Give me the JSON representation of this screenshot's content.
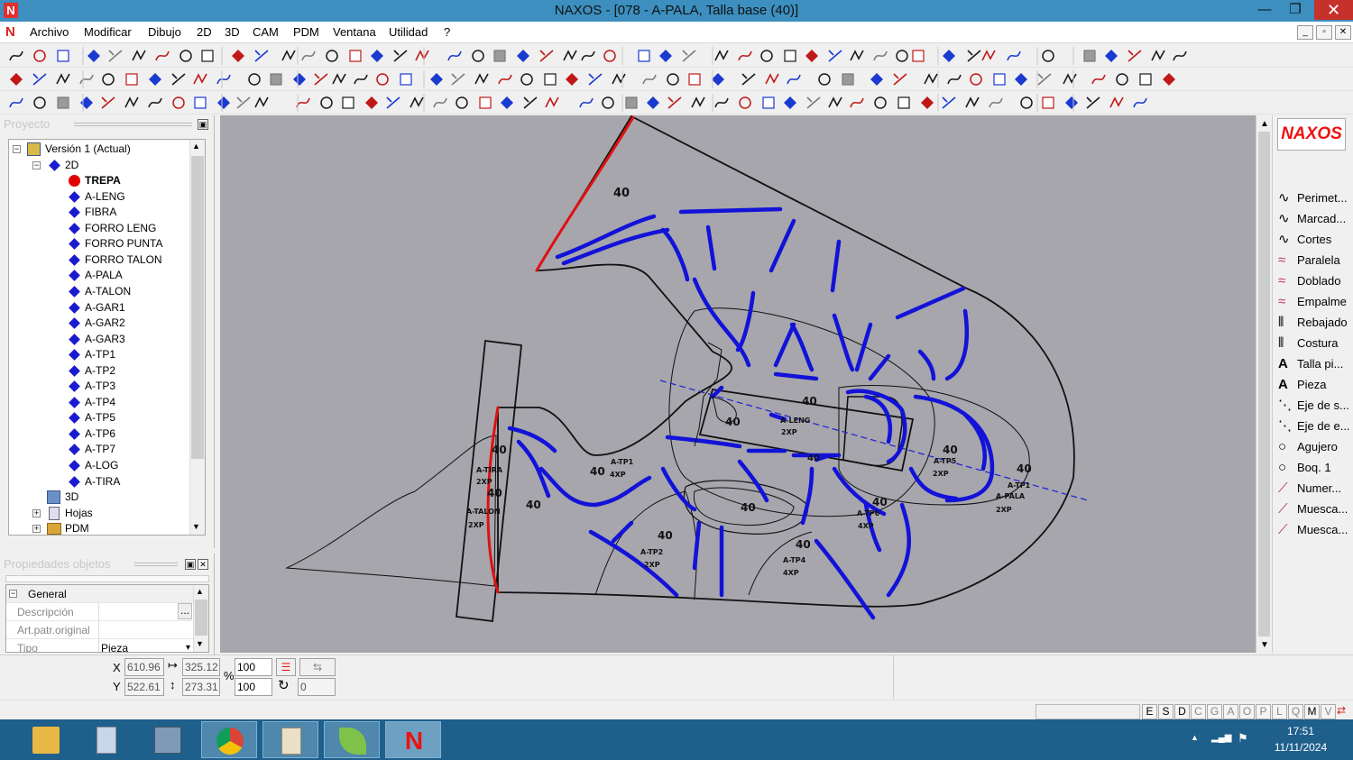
{
  "window": {
    "title": "NAXOS - [078 - A-PALA, Talla base (40)]",
    "logo": "N",
    "minimize": "—",
    "restore": "❐",
    "close": "✕"
  },
  "menu": [
    "Archivo",
    "Modificar",
    "Dibujo",
    "2D",
    "3D",
    "CAM",
    "PDM",
    "Ventana",
    "Utilidad",
    "?"
  ],
  "mdi": {
    "minimize": "_",
    "restore": "▫",
    "close": "✕"
  },
  "project_panel": {
    "title": "Proyecto",
    "pin": "▣"
  },
  "tree": [
    {
      "label": "Versión 1 (Actual)",
      "level": 0,
      "icon": "version-icon",
      "expander": "−"
    },
    {
      "label": "2D",
      "level": 1,
      "icon": "layer2d-icon",
      "expander": "−"
    },
    {
      "label": "TREPA",
      "level": 2,
      "icon": "red-dot-icon",
      "bold": true
    },
    {
      "label": "A-LENG",
      "level": 2,
      "icon": "diamond-icon"
    },
    {
      "label": "FIBRA",
      "level": 2,
      "icon": "diamond-icon"
    },
    {
      "label": "FORRO LENG",
      "level": 2,
      "icon": "diamond-icon"
    },
    {
      "label": "FORRO PUNTA",
      "level": 2,
      "icon": "diamond-icon"
    },
    {
      "label": "FORRO TALON",
      "level": 2,
      "icon": "diamond-icon"
    },
    {
      "label": "A-PALA",
      "level": 2,
      "icon": "diamond-icon"
    },
    {
      "label": "A-TALON",
      "level": 2,
      "icon": "diamond-icon"
    },
    {
      "label": "A-GAR1",
      "level": 2,
      "icon": "diamond-icon"
    },
    {
      "label": "A-GAR2",
      "level": 2,
      "icon": "diamond-icon"
    },
    {
      "label": "A-GAR3",
      "level": 2,
      "icon": "diamond-icon"
    },
    {
      "label": "A-TP1",
      "level": 2,
      "icon": "diamond-icon"
    },
    {
      "label": "A-TP2",
      "level": 2,
      "icon": "diamond-icon"
    },
    {
      "label": "A-TP3",
      "level": 2,
      "icon": "diamond-icon"
    },
    {
      "label": "A-TP4",
      "level": 2,
      "icon": "diamond-icon"
    },
    {
      "label": "A-TP5",
      "level": 2,
      "icon": "diamond-icon"
    },
    {
      "label": "A-TP6",
      "level": 2,
      "icon": "diamond-icon"
    },
    {
      "label": "A-TP7",
      "level": 2,
      "icon": "diamond-icon"
    },
    {
      "label": "A-LOG",
      "level": 2,
      "icon": "diamond-icon"
    },
    {
      "label": "A-TIRA",
      "level": 2,
      "icon": "diamond-icon"
    },
    {
      "label": "3D",
      "level": 1,
      "icon": "cube-icon"
    },
    {
      "label": "Hojas",
      "level": 1,
      "icon": "doc-icon",
      "expander": "+"
    },
    {
      "label": "PDM",
      "level": 1,
      "icon": "folder-icon",
      "expander": "+"
    }
  ],
  "props_panel": {
    "title": "Propiedades objetos",
    "pin": "▣",
    "close": "✕",
    "section": "General",
    "section_expander": "−",
    "rows": [
      {
        "key": "Descripción",
        "value": "",
        "button": "..."
      },
      {
        "key": "Art.patr.original",
        "value": ""
      },
      {
        "key": "Tipo",
        "value": "Pieza",
        "dropdown": "▾"
      }
    ]
  },
  "right_panel": {
    "logo": "NAXOS",
    "items": [
      {
        "label": "Perimet...",
        "icon": "curve-icon"
      },
      {
        "label": "Marcad...",
        "icon": "curve-icon"
      },
      {
        "label": "Cortes",
        "icon": "curve-icon"
      },
      {
        "label": "Paralela",
        "icon": "double-curve-icon"
      },
      {
        "label": "Doblado",
        "icon": "double-curve-icon"
      },
      {
        "label": "Empalme",
        "icon": "double-curve-icon"
      },
      {
        "label": "Rebajado",
        "icon": "stitch-icon"
      },
      {
        "label": "Costura",
        "icon": "stitch-icon"
      },
      {
        "label": "Talla pi...",
        "icon": "text-a-icon"
      },
      {
        "label": "Pieza",
        "icon": "text-a-icon"
      },
      {
        "label": "Eje de s...",
        "icon": "axis-icon"
      },
      {
        "label": "Eje de e...",
        "icon": "axis-icon"
      },
      {
        "label": "Agujero",
        "icon": "circle-icon"
      },
      {
        "label": "Boq. 1",
        "icon": "circle-icon"
      },
      {
        "label": "Numer...",
        "icon": "notch-icon"
      },
      {
        "label": "Muesca...",
        "icon": "notch-icon"
      },
      {
        "label": "Muesca...",
        "icon": "notch-icon"
      }
    ]
  },
  "coords": {
    "x_label": "X",
    "y_label": "Y",
    "x": "610.96",
    "y": "522.61",
    "w": "325.12",
    "h": "273.31",
    "sx": "100",
    "sy": "100",
    "pct": "%",
    "angle": "0"
  },
  "status_flags": [
    "E",
    "S",
    "D",
    "C",
    "G",
    "A",
    "O",
    "P",
    "L",
    "Q",
    "M",
    "V"
  ],
  "drawing_labels": [
    {
      "text": "40"
    },
    {
      "text": "40"
    },
    {
      "text": "40"
    },
    {
      "text": "A-LENG"
    },
    {
      "text": "2XP"
    },
    {
      "text": "40"
    },
    {
      "text": "40"
    },
    {
      "text": "A-TIRA"
    },
    {
      "text": "2XP"
    },
    {
      "text": "40"
    },
    {
      "text": "A-TALON"
    },
    {
      "text": "2XP"
    },
    {
      "text": "40"
    },
    {
      "text": "A-TP1"
    },
    {
      "text": "4XP"
    },
    {
      "text": "40"
    },
    {
      "text": "40"
    },
    {
      "text": "A-TP2"
    },
    {
      "text": "2XP"
    },
    {
      "text": "40"
    },
    {
      "text": "A-TP4"
    },
    {
      "text": "4XP"
    },
    {
      "text": "40"
    },
    {
      "text": "A-TP6"
    },
    {
      "text": "4XP"
    },
    {
      "text": "40"
    },
    {
      "text": "A-TP5"
    },
    {
      "text": "2XP"
    },
    {
      "text": "40"
    },
    {
      "text": "A-TP1"
    },
    {
      "text": "A-PALA"
    },
    {
      "text": "2XP"
    },
    {
      "text": "40"
    }
  ],
  "colors": {
    "titlebar": "#3c8fbf",
    "canvas": "#a6a6ac",
    "outline": "#111111",
    "stitch": "#1212d8",
    "trepa": "#e01010",
    "taskbar": "#1e5f8c"
  },
  "taskbar": {
    "apps": [
      "file-explorer-icon",
      "calculator-icon",
      "computer-icon",
      "chrome-icon",
      "folder-app-icon",
      "green-leaf-icon",
      "naxos-icon"
    ],
    "time": "17:51",
    "date": "11/11/2024",
    "tray_arrow": "▲",
    "signal": "▂▄▆",
    "flag": "⚑"
  }
}
